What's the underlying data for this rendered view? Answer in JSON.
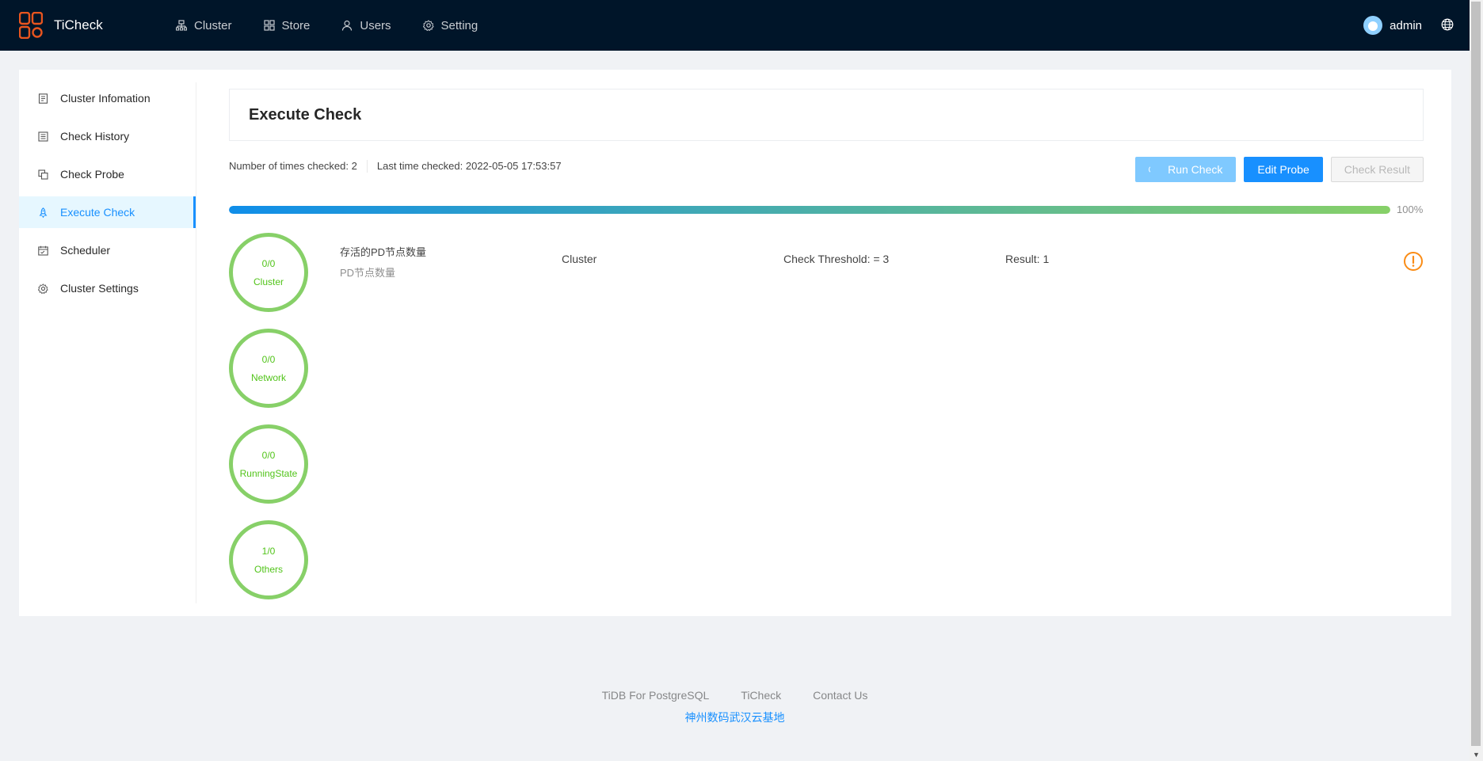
{
  "app": {
    "title": "TiCheck",
    "brand_color": "#e8551f"
  },
  "nav": [
    {
      "label": "Cluster",
      "icon": "cluster-icon"
    },
    {
      "label": "Store",
      "icon": "appstore-icon"
    },
    {
      "label": "Users",
      "icon": "user-icon"
    },
    {
      "label": "Setting",
      "icon": "setting-icon"
    }
  ],
  "user": {
    "name": "admin"
  },
  "sidebar": {
    "items": [
      {
        "label": "Cluster Infomation",
        "icon": "file-icon"
      },
      {
        "label": "Check History",
        "icon": "list-icon"
      },
      {
        "label": "Check Probe",
        "icon": "copy-icon"
      },
      {
        "label": "Execute Check",
        "icon": "rocket-icon",
        "active": true
      },
      {
        "label": "Scheduler",
        "icon": "schedule-icon"
      },
      {
        "label": "Cluster Settings",
        "icon": "setting-icon"
      }
    ]
  },
  "main": {
    "title": "Execute Check",
    "stats": {
      "times_checked": "Number of times checked: 2",
      "last_checked": "Last time checked: 2022-05-05 17:53:57"
    },
    "buttons": {
      "run": "Run Check",
      "edit": "Edit Probe",
      "result": "Check Result"
    },
    "progress": {
      "percent": 100,
      "label": "100%"
    },
    "categories": [
      {
        "count": "0/0",
        "name": "Cluster"
      },
      {
        "count": "0/0",
        "name": "Network"
      },
      {
        "count": "0/0",
        "name": "RunningState"
      },
      {
        "count": "1/0",
        "name": "Others"
      }
    ],
    "result": {
      "probe_name": "存活的PD节点数量",
      "probe_desc": "PD节点数量",
      "category": "Cluster",
      "threshold": "Check Threshold: = 3",
      "result": "Result: 1",
      "status_color": "#fa8c16"
    }
  },
  "footer": {
    "links": [
      "TiDB For PostgreSQL",
      "TiCheck",
      "Contact Us"
    ],
    "org": "神州数码武汉云基地"
  }
}
